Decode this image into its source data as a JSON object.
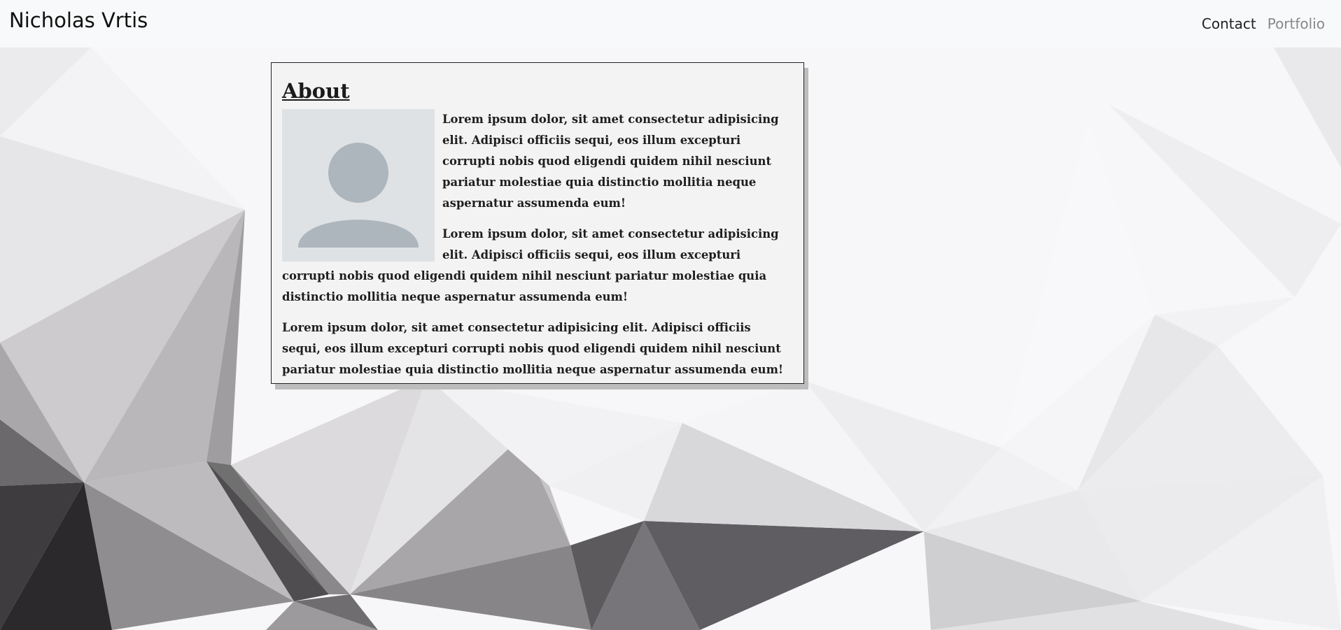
{
  "navbar": {
    "brand": "Nicholas Vrtis",
    "links": [
      {
        "label": "Contact"
      },
      {
        "label": "Portfolio"
      }
    ]
  },
  "about": {
    "title": "About",
    "avatar_icon": "user-silhouette-icon",
    "paragraphs": [
      "Lorem ipsum dolor, sit amet consectetur adipisicing elit. Adipisci officiis sequi, eos illum excepturi corrupti nobis quod eligendi quidem nihil nesciunt pariatur molestiae quia distinctio mollitia neque aspernatur assumenda eum!",
      "Lorem ipsum dolor, sit amet consectetur adipisicing elit. Adipisci officiis sequi, eos illum excepturi corrupti nobis quod eligendi quidem nihil nesciunt pariatur molestiae quia distinctio mollitia neque aspernatur assumenda eum!",
      "Lorem ipsum dolor, sit amet consectetur adipisicing elit. Adipisci officiis sequi, eos illum excepturi corrupti nobis quod eligendi quidem nihil nesciunt pariatur molestiae quia distinctio mollitia neque aspernatur assumenda eum!"
    ]
  },
  "colors": {
    "navbar_bg": "#f8f9fa",
    "card_bg": "#f3f3f3",
    "card_border": "#222222",
    "avatar_bg": "#dfe2e4",
    "avatar_fg": "#adb5bd"
  }
}
